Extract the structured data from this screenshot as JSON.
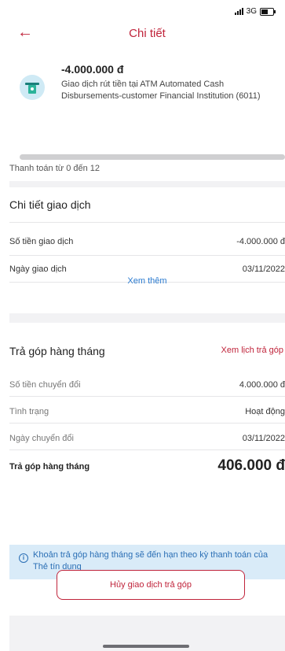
{
  "status_bar": {
    "network": "3G"
  },
  "header": {
    "back_icon": "arrow-left",
    "title": "Chi tiết"
  },
  "transaction": {
    "amount": "-4.000.000 đ",
    "icon": "atm-icon",
    "description": "Giao dịch rút tiền tại ATM Automated Cash Disbursements-customer Financial Institution (6011)",
    "payment_progress_fraction": 0,
    "payment_note": "Thanh toán từ 0 đến 12"
  },
  "details": {
    "title": "Chi tiết giao dịch",
    "rows": [
      {
        "label": "Số tiền giao dịch",
        "value": "-4.000.000 đ"
      },
      {
        "label": "Ngày giao dịch",
        "value": "03/11/2022"
      }
    ],
    "more": "Xem thêm"
  },
  "installment": {
    "title": "Trả góp hàng tháng",
    "schedule_link": "Xem lịch trả góp",
    "rows": [
      {
        "label": "Số tiền chuyển đổi",
        "value": "4.000.000 đ"
      },
      {
        "label": "Tình trạng",
        "value": "Hoạt động"
      },
      {
        "label": "Ngày chuyển đổi",
        "value": "03/11/2022"
      }
    ],
    "monthly_label": "Trả góp hàng tháng",
    "monthly_amount": "406.000 đ"
  },
  "info": {
    "icon": "info-icon",
    "text": "Khoản trả góp hàng tháng sẽ đến hạn theo kỳ thanh toán của Thẻ tín dụng"
  },
  "actions": {
    "cancel_label": "Hủy giao dịch trả góp"
  },
  "colors": {
    "accent": "#c0243b",
    "link": "#2b7bd0",
    "info_bg": "#d9ebf8"
  }
}
